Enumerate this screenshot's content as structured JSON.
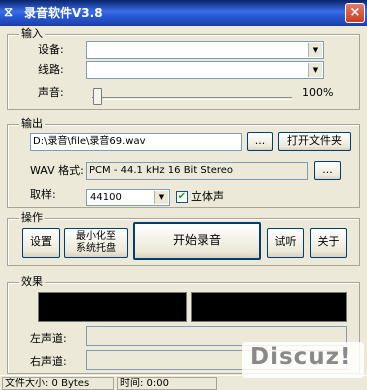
{
  "window": {
    "title": "录音软件V3.8",
    "icon_name": "mixer-app-icon",
    "close_glyph": "×",
    "accent": "#2a5ad8"
  },
  "input": {
    "group_label": "输入",
    "device_label": "设备:",
    "device_value": "",
    "line_label": "线路:",
    "line_value": "",
    "volume_label": "声音:",
    "volume_level": 0.02,
    "volume_text": "100%"
  },
  "output": {
    "group_label": "输出",
    "path_value": "D:\\录音\\file\\录音69.wav",
    "browse_label": "...",
    "open_folder_label": "打开文件夹",
    "wav_format_label": "WAV 格式:",
    "wav_format_value": "PCM - 44.1 kHz 16 Bit Stereo",
    "format_browse_label": "...",
    "sample_label": "取样:",
    "sample_value": "44100",
    "stereo_label": "立体声",
    "stereo_checked": true
  },
  "operations": {
    "group_label": "操作",
    "settings_label": "设置",
    "minimize_tray_label": "最小化至\n系统托盘",
    "start_record_label": "开始录音",
    "listen_label": "试听",
    "about_label": "关于"
  },
  "effects": {
    "group_label": "效果",
    "left_channel_label": "左声道:",
    "right_channel_label": "右声道:"
  },
  "status": {
    "file_size": "文件大小: 0 Bytes",
    "time": "时间: 0:00"
  },
  "watermark": "Discuz!"
}
